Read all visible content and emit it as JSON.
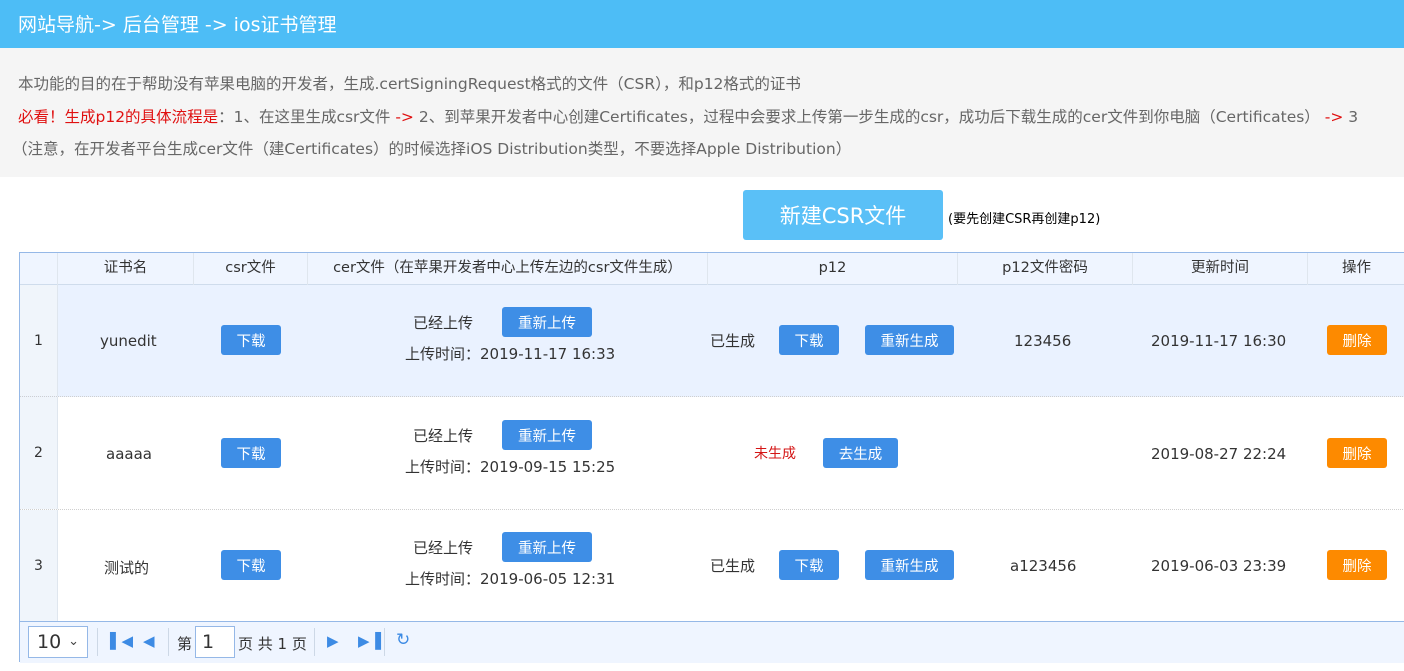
{
  "breadcrumb": "网站导航-> 后台管理 -> ios证书管理",
  "notice": {
    "line1": "本功能的目的在于帮助没有苹果电脑的开发者，生成.certSigningRequest格式的文件（CSR），和p12格式的证书",
    "line2_red": "必看！生成p12的具体流程是",
    "line2_a": "：1、在这里生成csr文件 ",
    "arrow": "->",
    "line2_b": " 2、到苹果开发者中心创建Certificates，过程中会要求上传第一步生成的csr，成功后下载生成的cer文件到你电脑（Certificates） ",
    "line2_c": " 3",
    "line3": "（注意，在开发者平台生成cer文件（建Certificates）的时候选择iOS Distribution类型，不要选择Apple Distribution）"
  },
  "new_button": "新建CSR文件",
  "new_hint": "(要先创建CSR再创建p12)",
  "columns": [
    "证书名",
    "csr文件",
    "cer文件（在苹果开发者中心上传左边的csr文件生成）",
    "p12",
    "p12文件密码",
    "更新时间",
    "操作"
  ],
  "labels": {
    "download": "下载",
    "reupload": "重新上传",
    "uploaded": "已经上传",
    "upload_time_prefix": "上传时间：",
    "generated": "已生成",
    "not_generated": "未生成",
    "regenerate": "重新生成",
    "go_generate": "去生成",
    "delete": "删除"
  },
  "rows": [
    {
      "num": "1",
      "name": "yunedit",
      "upload_time": "2019-11-17 16:33",
      "p12_generated": true,
      "password": "123456",
      "updated": "2019-11-17 16:30"
    },
    {
      "num": "2",
      "name": "aaaaa",
      "upload_time": "2019-09-15 15:25",
      "p12_generated": false,
      "password": "",
      "updated": "2019-08-27 22:24"
    },
    {
      "num": "3",
      "name": "测试的",
      "upload_time": "2019-06-05 12:31",
      "p12_generated": true,
      "password": "a123456",
      "updated": "2019-06-03 23:39"
    }
  ],
  "pager": {
    "page_size": "10",
    "page_prefix": "第",
    "page_value": "1",
    "page_suffix": "页 共 1 页",
    "icons": [
      "first-page-icon",
      "prev-page-icon",
      "next-page-icon",
      "last-page-icon",
      "refresh-icon"
    ]
  },
  "colors": {
    "topbar": "#4dbdf6",
    "button_blue": "#3e8ee6",
    "button_orange": "#fd8a00",
    "new_button": "#5ac0f7",
    "warning_red": "#e01010"
  }
}
